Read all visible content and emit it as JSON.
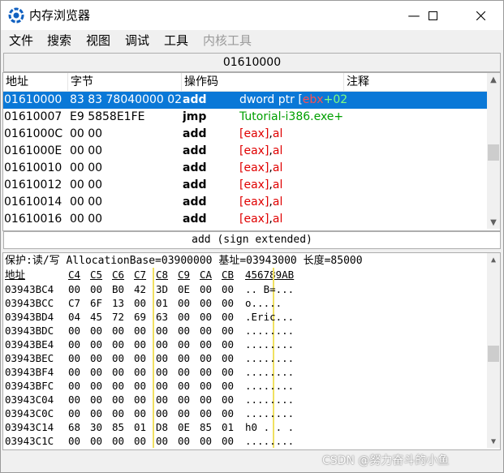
{
  "window": {
    "title": "内存浏览器",
    "minimize": "—",
    "maximize": "☐",
    "close": "✕"
  },
  "menu": [
    "文件",
    "搜索",
    "视图",
    "调试",
    "工具",
    "内核工具"
  ],
  "address_bar": "01610000",
  "disasm": {
    "headers": [
      "地址",
      "字节",
      "操作码",
      "注释"
    ],
    "rows": [
      {
        "addr": "01610000",
        "bytes": "83 83 78040000 02",
        "op": "add",
        "args": [
          {
            "t": "dword ptr [",
            "c": "a1"
          },
          {
            "t": "ebx",
            "c": "a2"
          },
          {
            "t": "+02",
            "c": "a4"
          }
        ]
      },
      {
        "addr": "01610007",
        "bytes": "E9 5858E1FE",
        "op": "jmp",
        "args": [
          {
            "t": "Tutorial-i386.exe+",
            "c": "green"
          }
        ]
      },
      {
        "addr": "0161000C",
        "bytes": "00 00",
        "op": "add",
        "args": [
          {
            "t": "[eax]",
            "c": "red"
          },
          {
            "t": ",",
            "c": ""
          },
          {
            "t": "al",
            "c": "red"
          }
        ]
      },
      {
        "addr": "0161000E",
        "bytes": "00 00",
        "op": "add",
        "args": [
          {
            "t": "[eax]",
            "c": "red"
          },
          {
            "t": ",",
            "c": ""
          },
          {
            "t": "al",
            "c": "red"
          }
        ]
      },
      {
        "addr": "01610010",
        "bytes": "00 00",
        "op": "add",
        "args": [
          {
            "t": "[eax]",
            "c": "red"
          },
          {
            "t": ",",
            "c": ""
          },
          {
            "t": "al",
            "c": "red"
          }
        ]
      },
      {
        "addr": "01610012",
        "bytes": "00 00",
        "op": "add",
        "args": [
          {
            "t": "[eax]",
            "c": "red"
          },
          {
            "t": ",",
            "c": ""
          },
          {
            "t": "al",
            "c": "red"
          }
        ]
      },
      {
        "addr": "01610014",
        "bytes": "00 00",
        "op": "add",
        "args": [
          {
            "t": "[eax]",
            "c": "red"
          },
          {
            "t": ",",
            "c": ""
          },
          {
            "t": "al",
            "c": "red"
          }
        ]
      },
      {
        "addr": "01610016",
        "bytes": "00 00",
        "op": "add",
        "args": [
          {
            "t": "[eax]",
            "c": "red"
          },
          {
            "t": ",",
            "c": ""
          },
          {
            "t": "al",
            "c": "red"
          }
        ]
      }
    ]
  },
  "instruction_info": "add (sign extended)",
  "hex": {
    "info": "保护:读/写  AllocationBase=03900000 基址=03943000 长度=85000",
    "header_label": "地址",
    "columns": [
      "C4",
      "C5",
      "C6",
      "C7",
      "C8",
      "C9",
      "CA",
      "CB"
    ],
    "ascii_header": "456789AB",
    "rows": [
      {
        "addr": "03943BC4",
        "bytes": [
          "00",
          "00",
          "B0",
          "42",
          "3D",
          "0E",
          "00",
          "00"
        ],
        "ascii": "..  B=..."
      },
      {
        "addr": "03943BCC",
        "bytes": [
          "C7",
          "6F",
          "13",
          "00",
          "01",
          "00",
          "00",
          "00"
        ],
        "ascii": " o....."
      },
      {
        "addr": "03943BD4",
        "bytes": [
          "04",
          "45",
          "72",
          "69",
          "63",
          "00",
          "00",
          "00"
        ],
        "ascii": ".Eric..."
      },
      {
        "addr": "03943BDC",
        "bytes": [
          "00",
          "00",
          "00",
          "00",
          "00",
          "00",
          "00",
          "00"
        ],
        "ascii": "........"
      },
      {
        "addr": "03943BE4",
        "bytes": [
          "00",
          "00",
          "00",
          "00",
          "00",
          "00",
          "00",
          "00"
        ],
        "ascii": "........"
      },
      {
        "addr": "03943BEC",
        "bytes": [
          "00",
          "00",
          "00",
          "00",
          "00",
          "00",
          "00",
          "00"
        ],
        "ascii": "........"
      },
      {
        "addr": "03943BF4",
        "bytes": [
          "00",
          "00",
          "00",
          "00",
          "00",
          "00",
          "00",
          "00"
        ],
        "ascii": "........"
      },
      {
        "addr": "03943BFC",
        "bytes": [
          "00",
          "00",
          "00",
          "00",
          "00",
          "00",
          "00",
          "00"
        ],
        "ascii": "........"
      },
      {
        "addr": "03943C04",
        "bytes": [
          "00",
          "00",
          "00",
          "00",
          "00",
          "00",
          "00",
          "00"
        ],
        "ascii": "........"
      },
      {
        "addr": "03943C0C",
        "bytes": [
          "00",
          "00",
          "00",
          "00",
          "00",
          "00",
          "00",
          "00"
        ],
        "ascii": "........"
      },
      {
        "addr": "03943C14",
        "bytes": [
          "68",
          "30",
          "85",
          "01",
          "D8",
          "0E",
          "85",
          "01"
        ],
        "ascii": "h0 . . ."
      },
      {
        "addr": "03943C1C",
        "bytes": [
          "00",
          "00",
          "00",
          "00",
          "00",
          "00",
          "00",
          "00"
        ],
        "ascii": "........"
      }
    ]
  },
  "watermark": "CSDN @努力奋斗的小鱼"
}
